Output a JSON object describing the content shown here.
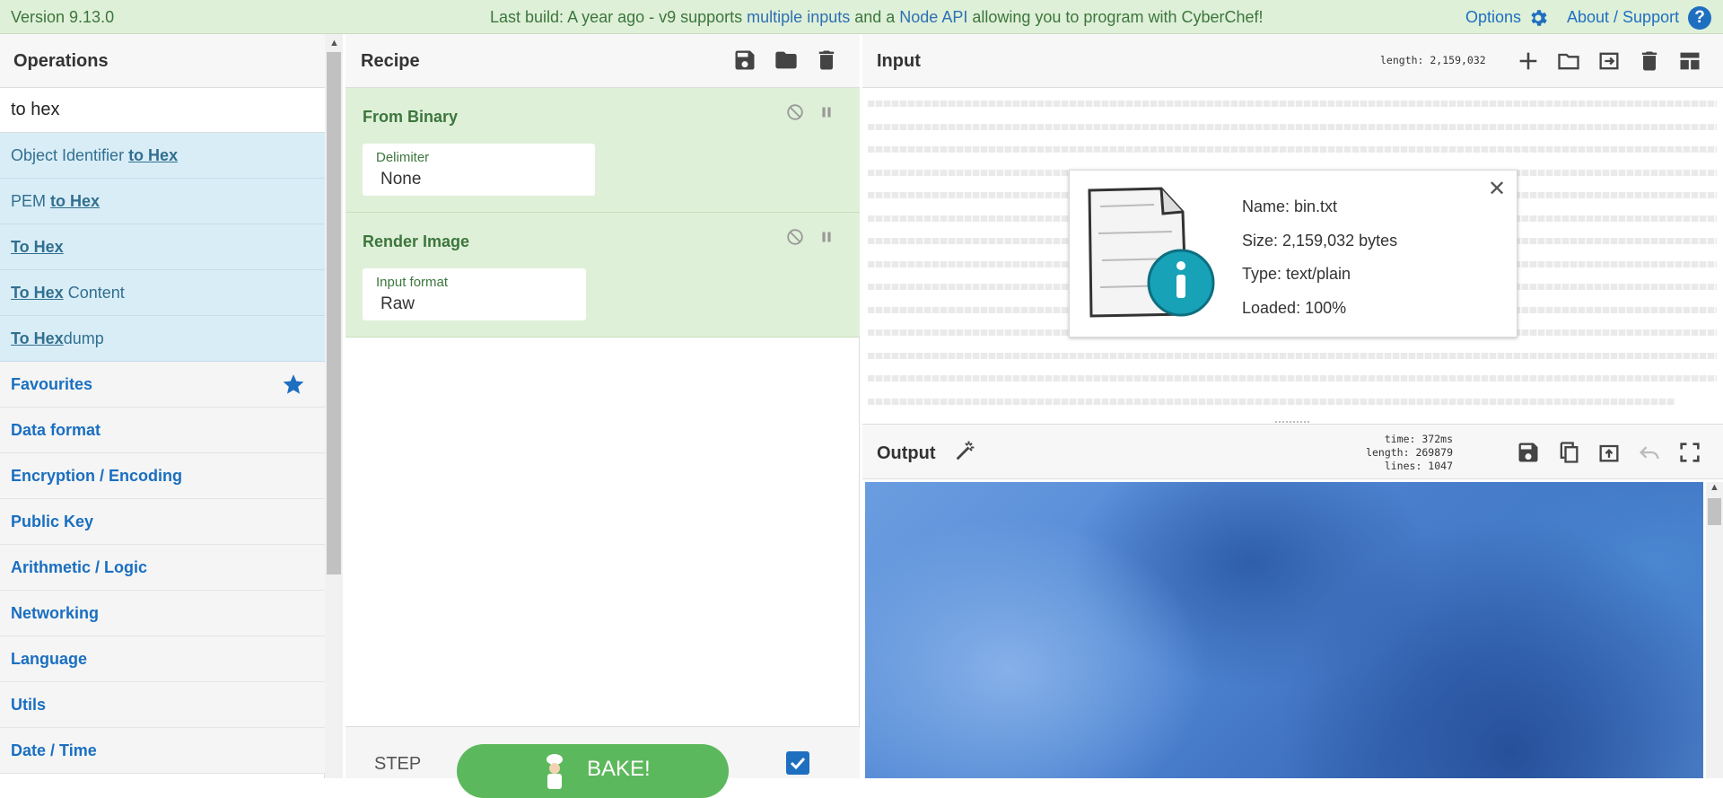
{
  "banner": {
    "version": "Version 9.13.0",
    "build_prefix": "Last build: A year ago - v9 supports ",
    "build_link1": "multiple inputs",
    "build_mid": " and a ",
    "build_link2": "Node API",
    "build_suffix": " allowing you to program with CyberChef!",
    "options_label": "Options",
    "about_label": "About / Support",
    "help_glyph": "?"
  },
  "operations": {
    "title": "Operations",
    "search_value": "to hex",
    "results": [
      {
        "pre": "Object Identifier ",
        "match": "to Hex",
        "post": ""
      },
      {
        "pre": "PEM ",
        "match": "to Hex",
        "post": ""
      },
      {
        "pre": "",
        "match": "To Hex",
        "post": ""
      },
      {
        "pre": "",
        "match": "To Hex",
        "post": " Content"
      },
      {
        "pre": "",
        "match": "To Hex",
        "post": "dump"
      }
    ],
    "categories": [
      "Favourites",
      "Data format",
      "Encryption / Encoding",
      "Public Key",
      "Arithmetic / Logic",
      "Networking",
      "Language",
      "Utils",
      "Date / Time"
    ]
  },
  "recipe": {
    "title": "Recipe",
    "ops": [
      {
        "name": "From Binary",
        "arg_label": "Delimiter",
        "arg_value": "None"
      },
      {
        "name": "Render Image",
        "arg_label": "Input format",
        "arg_value": "Raw"
      }
    ],
    "step_label": "STEP",
    "bake_label": "BAKE!"
  },
  "input": {
    "title": "Input",
    "length_stat": "length: 2,159,032"
  },
  "file_details": {
    "name": "Name: bin.txt",
    "size": "Size: 2,159,032 bytes",
    "type": "Type: text/plain",
    "loaded": "Loaded: 100%"
  },
  "output": {
    "title": "Output",
    "time_stat": "time:  372ms",
    "length_stat": "length: 269879",
    "lines_stat": "lines:   1047"
  },
  "colors": {
    "banner_bg": "#dff0d8",
    "op_result_bg": "#d9edf7",
    "recipe_op_bg": "#dff0d8",
    "category_text": "#1a6fc0",
    "bake_green": "#5cb85c"
  }
}
